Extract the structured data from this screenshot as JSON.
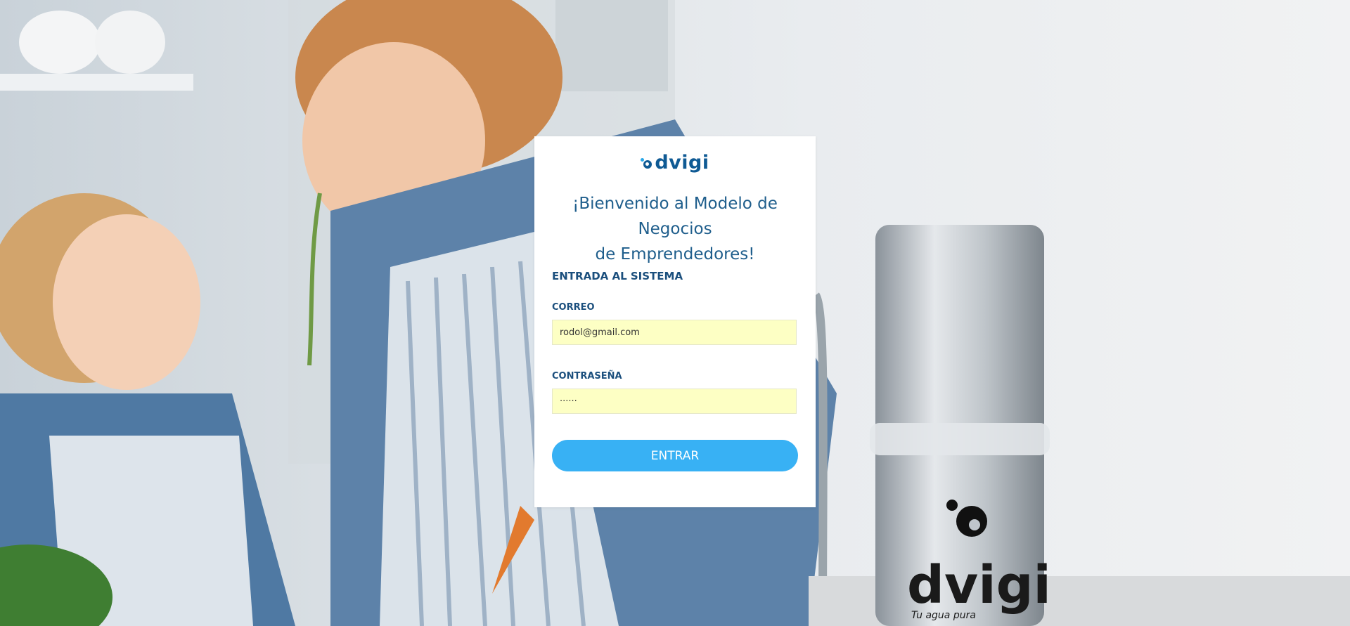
{
  "brand": {
    "logo_text": "dvigi",
    "product_logo_text": "dvigi",
    "product_tagline": "Tu agua pura"
  },
  "login": {
    "welcome_line1": "¡Bienvenido al Modelo de Negocios",
    "welcome_line2": "de Emprendedores!",
    "section_title": "ENTRADA AL SISTEMA",
    "email_label": "CORREO",
    "email_value": "rodol@gmail.com",
    "password_label": "CONTRASEÑA",
    "password_value": "······",
    "submit_label": "ENTRAR"
  },
  "colors": {
    "primary": "#0f5a94",
    "button": "#38b1f4",
    "input_bg": "#fdffc4"
  }
}
